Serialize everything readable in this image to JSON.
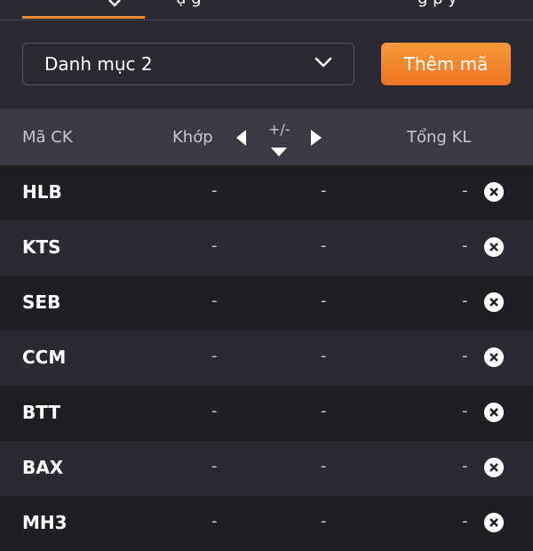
{
  "tabs": {
    "frag_1": "ụ   g",
    "frag_2": "g   p  y"
  },
  "selector": {
    "value": "Danh mục 2",
    "add_label": "Thêm mã"
  },
  "table": {
    "headers": {
      "code": "Mã CK",
      "match": "Khớp",
      "change": "+/-",
      "volume": "Tổng KL"
    },
    "rows": [
      {
        "code": "HLB",
        "match": "-",
        "change": "-",
        "volume": "-"
      },
      {
        "code": "KTS",
        "match": "-",
        "change": "-",
        "volume": "-"
      },
      {
        "code": "SEB",
        "match": "-",
        "change": "-",
        "volume": "-"
      },
      {
        "code": "CCM",
        "match": "-",
        "change": "-",
        "volume": "-"
      },
      {
        "code": "BTT",
        "match": "-",
        "change": "-",
        "volume": "-"
      },
      {
        "code": "BAX",
        "match": "-",
        "change": "-",
        "volume": "-"
      },
      {
        "code": "MH3",
        "match": "-",
        "change": "-",
        "volume": "-"
      }
    ]
  },
  "colors": {
    "accent": "#f08c2c",
    "background": "#2b2a33",
    "row_dark": "#1f1e23",
    "header": "#3b3a44"
  },
  "icons": {
    "select": "chevron-down-icon",
    "prev_col": "triangle-left-icon",
    "next_col": "triangle-right-icon",
    "sort": "sort-down-icon",
    "remove": "close-circle-icon"
  }
}
